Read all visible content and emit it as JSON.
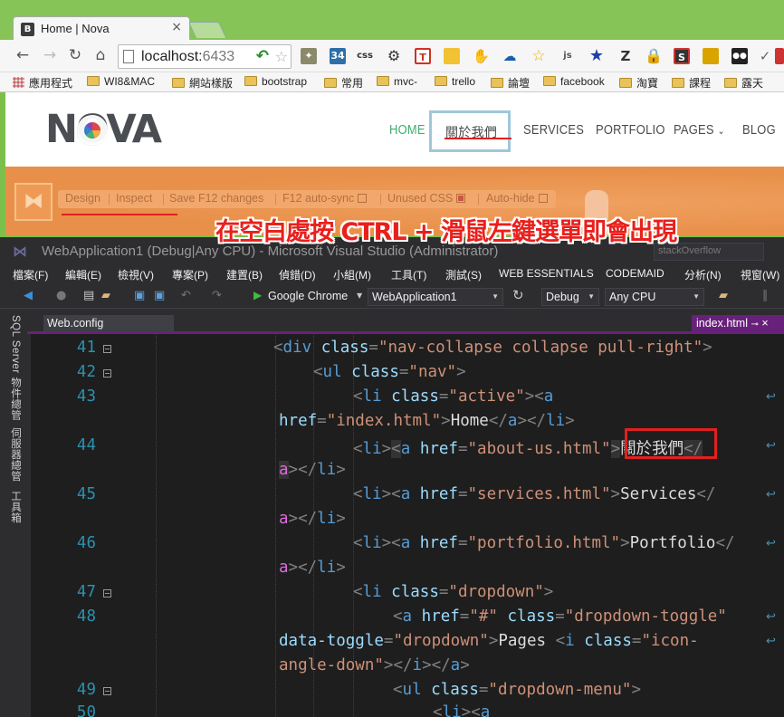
{
  "browser": {
    "tab_favicon": "B",
    "tab_title": "Home | Nova",
    "address_host": "localhost:",
    "address_port": "6433",
    "bookmarks": [
      {
        "label": "應用程式",
        "icon": "apps-icon"
      },
      {
        "label": "WI8&MAC",
        "icon": "folder-icon"
      },
      {
        "label": "網站樣版",
        "icon": "folder-icon"
      },
      {
        "label": "bootstrap",
        "icon": "folder-icon"
      },
      {
        "label": "常用",
        "icon": "folder-icon"
      },
      {
        "label": "mvc-",
        "icon": "folder-icon"
      },
      {
        "label": "trello",
        "icon": "folder-icon"
      },
      {
        "label": "論壇",
        "icon": "folder-icon"
      },
      {
        "label": "facebook",
        "icon": "folder-icon"
      },
      {
        "label": "淘寶",
        "icon": "folder-icon"
      },
      {
        "label": "課程",
        "icon": "folder-icon"
      },
      {
        "label": "露天",
        "icon": "folder-icon"
      }
    ],
    "extensions": [
      "34",
      "css",
      "T",
      "js",
      "Z",
      "S"
    ]
  },
  "site": {
    "logo": "NOVA",
    "menu": [
      "HOME",
      "關於我們",
      "SERVICES",
      "PORTFOLIO",
      "PAGES",
      "BLOG"
    ]
  },
  "web_essentials": {
    "items": [
      "Design",
      "Inspect",
      "Save F12 changes",
      "F12 auto-sync",
      "Unused CSS",
      "Auto-hide"
    ]
  },
  "annotation": "在空白處按 CTRL + 滑鼠左鍵選單即會出現",
  "vs": {
    "title": "WebApplication1 (Debug|Any CPU) - Microsoft Visual Studio (Administrator)",
    "quick_launch": "stackOverflow",
    "menu": [
      "檔案(F)",
      "編輯(E)",
      "檢視(V)",
      "專案(P)",
      "建置(B)",
      "偵錯(D)",
      "小組(M)",
      "工具(T)",
      "測試(S)",
      "WEB ESSENTIALS",
      "CODEMAID",
      "分析(N)",
      "視窗(W)"
    ],
    "browser_target": "Google Chrome",
    "project": "WebApplication1",
    "config": "Debug",
    "platform": "Any CPU",
    "side_tabs": [
      "SQL Server 物件總管",
      "伺服器總管",
      "工具箱"
    ],
    "tab_left": "Web.config",
    "tab_right": "index.html",
    "line_numbers": [
      "41",
      "42",
      "43",
      "44",
      "45",
      "46",
      "47",
      "48",
      "49",
      "50"
    ]
  },
  "colors": {
    "accent_orange": "#e8904a",
    "vs_purple": "#68217a",
    "annotation_red": "#e8201c",
    "nova_green": "#3fae6e"
  }
}
